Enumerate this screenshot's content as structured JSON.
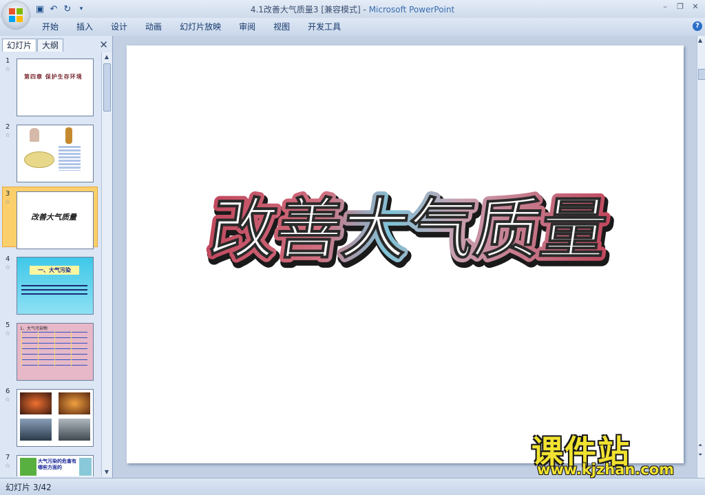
{
  "window": {
    "title": "4.1改善大气质量3 [兼容模式]",
    "app_name": "Microsoft PowerPoint",
    "separator": " - "
  },
  "qat": {
    "save_icon": "save-icon",
    "undo_icon": "undo-icon",
    "redo_icon": "redo-icon",
    "customize_icon": "chevron-down-icon"
  },
  "ribbon": {
    "tabs": [
      "开始",
      "插入",
      "设计",
      "动画",
      "幻灯片放映",
      "审阅",
      "视图",
      "开发工具"
    ],
    "help": "?"
  },
  "panel": {
    "tabs": [
      "幻灯片",
      "大纲"
    ],
    "close": "✕",
    "slides": [
      {
        "num": "1",
        "thumb_text": "第四章 保护生存环境"
      },
      {
        "num": "2",
        "thumb_text": ""
      },
      {
        "num": "3",
        "thumb_text": "改善大气质量"
      },
      {
        "num": "4",
        "thumb_text": "一、大气污染"
      },
      {
        "num": "5",
        "thumb_text": "1、大气污染物"
      },
      {
        "num": "6",
        "thumb_text": ""
      },
      {
        "num": "7",
        "thumb_text": "大气污染的危害有哪些方面的"
      }
    ],
    "selected": 3
  },
  "slide": {
    "title": "改善大气质量"
  },
  "status": {
    "slide_info": "幻灯片 3/42"
  },
  "watermark": {
    "cn": "课件站",
    "url": "www.kjzhan.com"
  },
  "colors": {
    "title_red": "#c2495e",
    "title_cyan": "#7ec4d8",
    "selected": "#fbcf6b"
  }
}
